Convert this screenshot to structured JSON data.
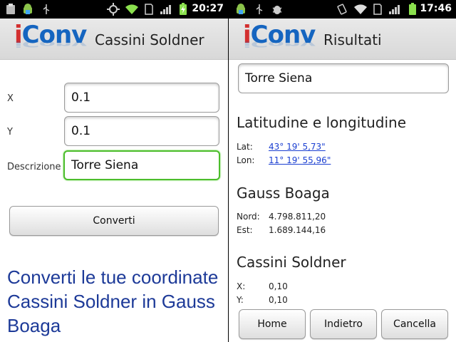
{
  "left": {
    "status": {
      "time": "20:27"
    },
    "app": {
      "logo_text": "iConv",
      "title": "Cassini Soldner"
    },
    "form": {
      "x": {
        "label": "X",
        "value": "0.1"
      },
      "y": {
        "label": "Y",
        "value": "0.1"
      },
      "descrizione": {
        "label": "Descrizione",
        "value": "Torre Siena"
      }
    },
    "convert_button": "Converti",
    "promo_text": "Converti le tue coordinate Cassini Soldner in Gauss Boaga"
  },
  "right": {
    "status": {
      "time": "17:46"
    },
    "app": {
      "logo_text": "iConv",
      "title": "Risultati"
    },
    "description_field": "Torre Siena",
    "latlon": {
      "heading": "Latitudine e longitudine",
      "lat_label": "Lat:",
      "lat_value": "43° 19' 5,73\"",
      "lon_label": "Lon:",
      "lon_value": "11° 19' 55,96\""
    },
    "gauss": {
      "heading": "Gauss Boaga",
      "nord_label": "Nord:",
      "nord_value": "4.798.811,20",
      "est_label": "Est:",
      "est_value": "1.689.144,16"
    },
    "cassini": {
      "heading": "Cassini Soldner",
      "x_label": "X:",
      "x_value": "0,10",
      "y_label": "Y:",
      "y_value": "0,10"
    },
    "buttons": {
      "home": "Home",
      "back": "Indietro",
      "clear": "Cancella"
    }
  },
  "icons": {
    "left_status": [
      "clipboard-icon",
      "android-debug-icon",
      "usb-icon",
      "gps-icon",
      "wifi-icon",
      "sd-card-icon",
      "signal-icon",
      "battery-charging-icon"
    ],
    "right_status": [
      "android-debug-icon",
      "usb-icon",
      "bug-icon",
      "vibrate-icon",
      "wifi-icon",
      "sd-card-icon",
      "signal-icon",
      "battery-icon"
    ]
  },
  "colors": {
    "logo_blue": "#1565c0",
    "logo_red": "#d32f2f",
    "focus_green": "#4cbd2c",
    "promo_blue": "#1d3a98",
    "link_blue": "#1b3fd1",
    "wifi_green": "#8be04e"
  }
}
